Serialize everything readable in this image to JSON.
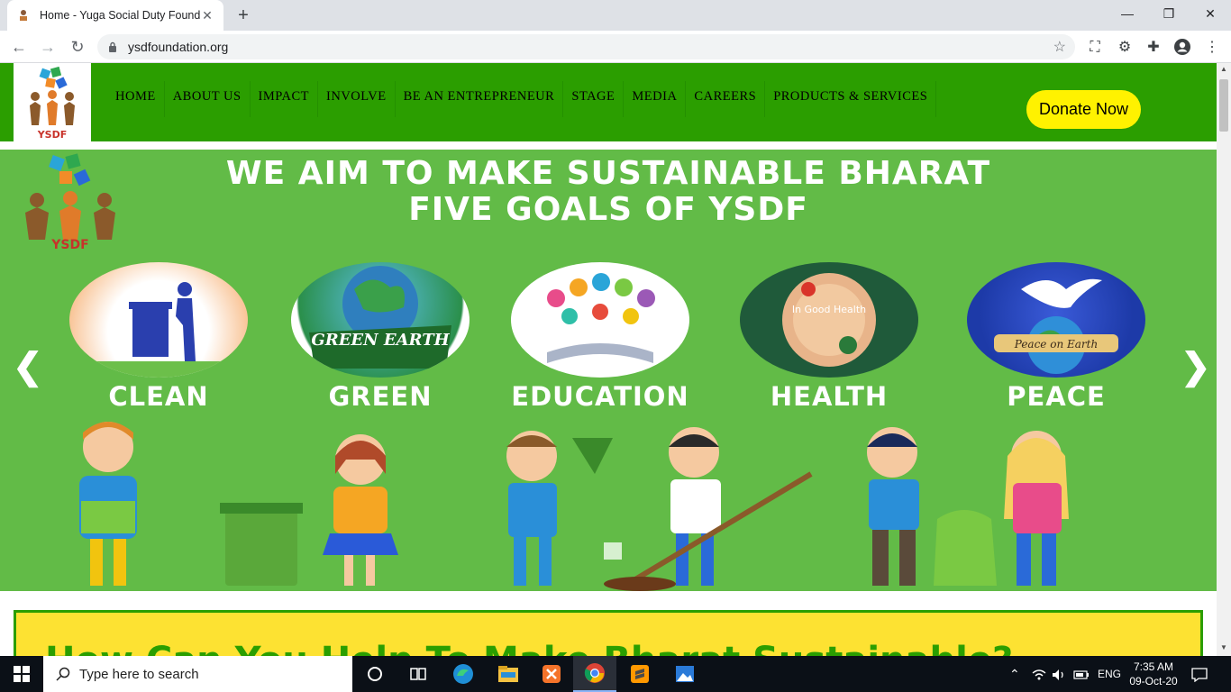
{
  "browser": {
    "tab_title": "Home - Yuga Social Duty Founda",
    "url": "ysdfoundation.org",
    "new_tab": "+",
    "close_tab": "✕"
  },
  "site": {
    "logo_text": "YSDF",
    "menu": [
      "HOME",
      "ABOUT US",
      "IMPACT",
      "INVOLVE",
      "BE AN ENTREPRENEUR",
      "STAGE",
      "MEDIA",
      "CAREERS",
      "PRODUCTS & SERVICES"
    ],
    "donate_label": "Donate Now"
  },
  "slider": {
    "headline_1": "WE AIM TO MAKE SUSTAINABLE BHARAT",
    "headline_2": "FIVE GOALS OF YSDF",
    "logo_text": "YSDF",
    "goals": [
      {
        "label": "CLEAN",
        "badge": "",
        "color": "#f5a25a"
      },
      {
        "label": "GREEN",
        "badge": "GREEN EARTH",
        "color": "#3a8f3a"
      },
      {
        "label": "EDUCATION",
        "badge": "",
        "color": "#ffffff"
      },
      {
        "label": "HEALTH",
        "badge": "In Good Health",
        "color": "#1f5a3a"
      },
      {
        "label": "PEACE",
        "badge": "Peace on Earth",
        "color": "#1d3aa8"
      }
    ],
    "prev": "❮",
    "next": "❯"
  },
  "section": {
    "heading": "How Can You Help To Make Bharat Sustainable?"
  },
  "taskbar": {
    "search_placeholder": "Type here to search",
    "language": "ENG",
    "time": "7:35 AM",
    "date": "09-Oct-20"
  }
}
